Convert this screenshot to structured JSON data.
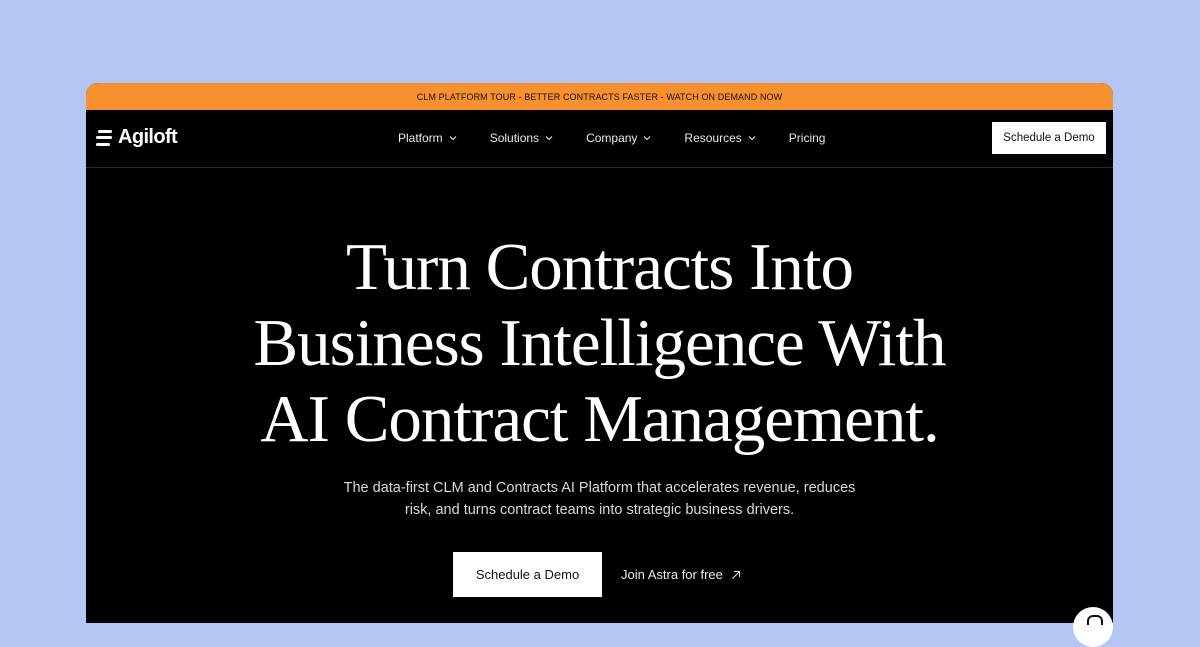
{
  "banner": {
    "text": "CLM PLATFORM TOUR - BETTER CONTRACTS FASTER - WATCH ON DEMAND NOW"
  },
  "nav": {
    "logo_text": "Agiloft",
    "items": [
      {
        "label": "Platform",
        "has_dropdown": true
      },
      {
        "label": "Solutions",
        "has_dropdown": true
      },
      {
        "label": "Company",
        "has_dropdown": true
      },
      {
        "label": "Resources",
        "has_dropdown": true
      },
      {
        "label": "Pricing",
        "has_dropdown": false
      }
    ],
    "cta_label": "Schedule a Demo"
  },
  "hero": {
    "title_line1": "Turn Contracts Into",
    "title_line2": "Business Intelligence With",
    "title_line3": "AI Contract Management.",
    "subtitle_line1": "The data-first CLM and Contracts AI Platform that accelerates revenue, reduces",
    "subtitle_line2": "risk, and turns contract teams into strategic business drivers.",
    "primary_cta": "Schedule a Demo",
    "secondary_cta": "Join Astra for free"
  },
  "colors": {
    "page_background": "#b5c6f4",
    "banner": "#f7902f",
    "site_background": "#000000",
    "button_background": "#ffffff"
  },
  "icons": [
    "logo-mark-icon",
    "chevron-down-icon",
    "arrow-up-right-icon",
    "chat-icon"
  ]
}
